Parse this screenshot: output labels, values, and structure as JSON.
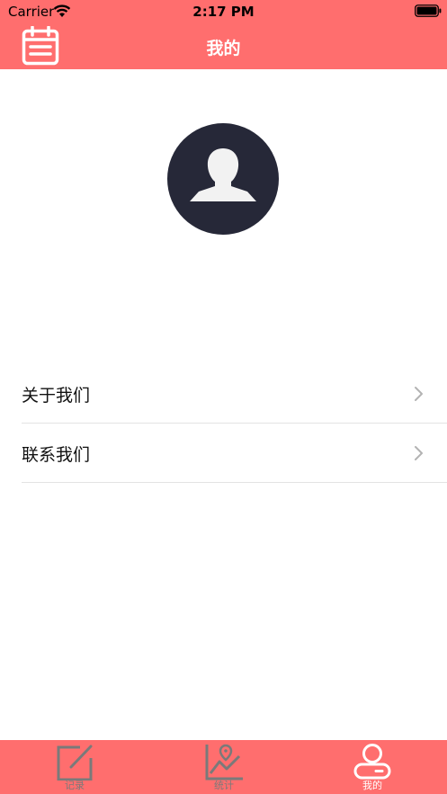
{
  "status_bar": {
    "carrier": "Carrier",
    "time": "2:17 PM"
  },
  "header": {
    "title": "我的",
    "left_icon": "calendar-icon",
    "background": "#ff6e6e"
  },
  "profile": {
    "avatar_icon": "user-avatar-icon",
    "avatar_background": "#262838"
  },
  "menu": [
    {
      "label": "关于我们",
      "icon": "chevron-right-icon"
    },
    {
      "label": "联系我们",
      "icon": "chevron-right-icon"
    }
  ],
  "tabbar": {
    "items": [
      {
        "label": "记录",
        "icon": "edit-icon",
        "active": false
      },
      {
        "label": "统计",
        "icon": "chart-icon",
        "active": false
      },
      {
        "label": "我的",
        "icon": "user-icon",
        "active": true
      }
    ],
    "active_color": "#ffffff",
    "inactive_color": "#7a7a7a"
  }
}
